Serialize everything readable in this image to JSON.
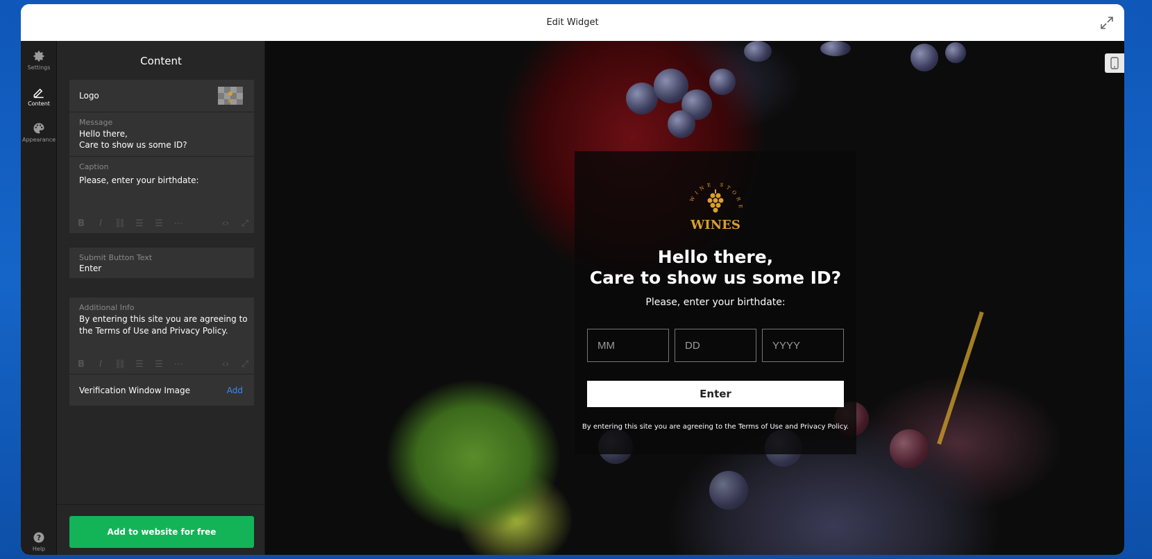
{
  "window": {
    "title": "Edit Widget"
  },
  "rail": {
    "items": [
      {
        "label": "Settings",
        "icon": "gear-icon"
      },
      {
        "label": "Content",
        "icon": "pencil-icon"
      },
      {
        "label": "Appearance",
        "icon": "palette-icon"
      }
    ],
    "help": {
      "label": "Help",
      "icon": "help-icon"
    }
  },
  "panel": {
    "title": "Content",
    "logo_label": "Logo",
    "message": {
      "label": "Message",
      "line1": "Hello there,",
      "line2": "Care to show us some ID?"
    },
    "caption": {
      "label": "Caption",
      "value": "Please, enter your birthdate:"
    },
    "submit": {
      "label": "Submit Button Text",
      "value": "Enter"
    },
    "additional": {
      "label": "Additional Info",
      "line1": "By entering this site you are agreeing to",
      "line2": "the Terms of Use and Privacy Policy."
    },
    "image": {
      "label": "Verification Window Image",
      "action": "Add"
    },
    "cta": "Add to website for free"
  },
  "preview": {
    "logo": {
      "arc_text": "WINE STORE",
      "wordmark": "WINES"
    },
    "title_line1": "Hello there,",
    "title_line2": "Care to show us some ID?",
    "caption": "Please, enter your birthdate:",
    "inputs": {
      "month": "MM",
      "day": "DD",
      "year": "YYYY"
    },
    "button": "Enter",
    "info": "By entering this site you are agreeing to the Terms of Use and Privacy Policy."
  },
  "colors": {
    "accent_green": "#12b457",
    "link_blue": "#3b8bf5",
    "logo_gold": "#d9a030"
  }
}
